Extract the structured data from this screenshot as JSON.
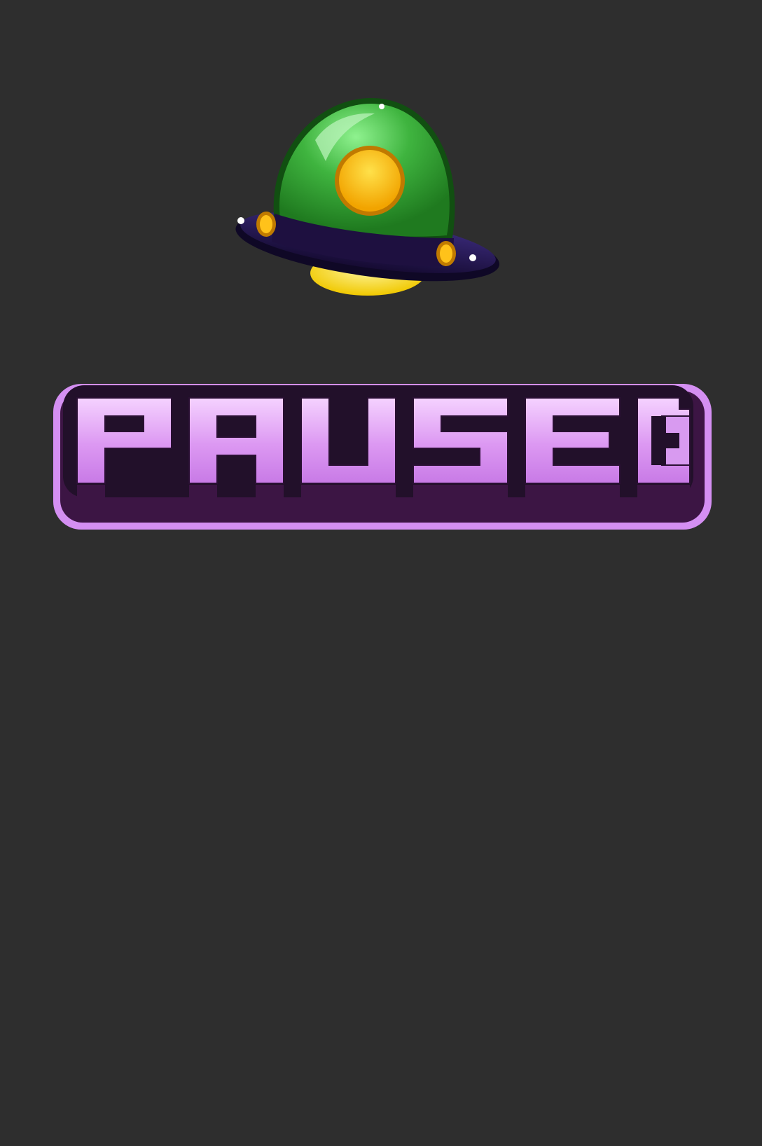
{
  "pause_screen": {
    "title": "PAUSED",
    "icon": "ufo-icon"
  },
  "colors": {
    "background": "#2e2e2e",
    "ufo_dome": "#2e9a2e",
    "ufo_dome_light": "#7de07d",
    "ufo_ring": "#1f1246",
    "ufo_light": "#f2d230",
    "ufo_core": "#f5b800",
    "title_fill": "#d98ef0",
    "title_fill_light": "#f2c8ff",
    "title_inner_outline": "#24102c",
    "title_outer_outline": "#d08df0",
    "title_shadow": "#3d1446"
  }
}
